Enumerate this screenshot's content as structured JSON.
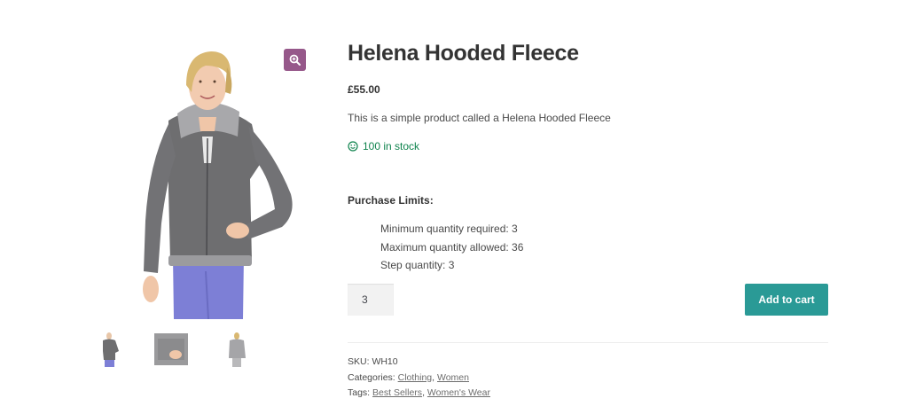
{
  "product": {
    "title": "Helena Hooded Fleece",
    "price": "£55.00",
    "description": "This is a simple product called a Helena Hooded Fleece",
    "stock_text": "100 in stock"
  },
  "purchase_limits": {
    "heading": "Purchase Limits:",
    "items": [
      "Minimum quantity required: 3",
      "Maximum quantity allowed: 36",
      "Step quantity: 3"
    ]
  },
  "cart": {
    "quantity": "3",
    "add_to_cart_label": "Add to cart"
  },
  "meta": {
    "sku_label": "SKU:",
    "sku_value": "WH10",
    "categories_label": "Categories:",
    "categories": [
      "Clothing",
      "Women"
    ],
    "tags_label": "Tags:",
    "tags": [
      "Best Sellers",
      "Women's Wear"
    ],
    "separator": ","
  },
  "icons": {
    "zoom": "zoom-icon",
    "stock": "smile-icon"
  },
  "colors": {
    "zoom_button": "#96588a",
    "add_to_cart": "#2a9a96",
    "in_stock": "#0f834d"
  }
}
